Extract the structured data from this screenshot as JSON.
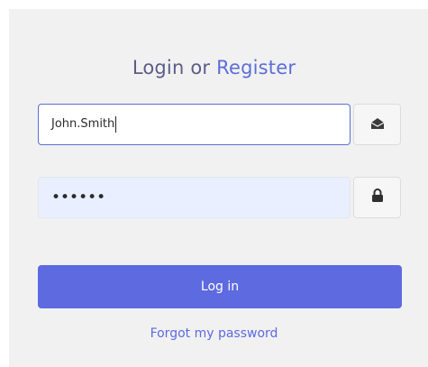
{
  "header": {
    "title_prefix": "Login or",
    "title_link": "Register"
  },
  "form": {
    "username_value": "John.Smith",
    "password_value": "••••••",
    "submit_label": "Log in",
    "forgot_label": "Forgot my password"
  },
  "icons": {
    "username_addon": "envelope-open-icon",
    "password_addon": "lock-icon"
  },
  "colors": {
    "accent": "#5d6ae0",
    "card_background": "#f1f1f1",
    "password_field_background": "#e9efff",
    "heading_text": "#5c5c8a"
  }
}
